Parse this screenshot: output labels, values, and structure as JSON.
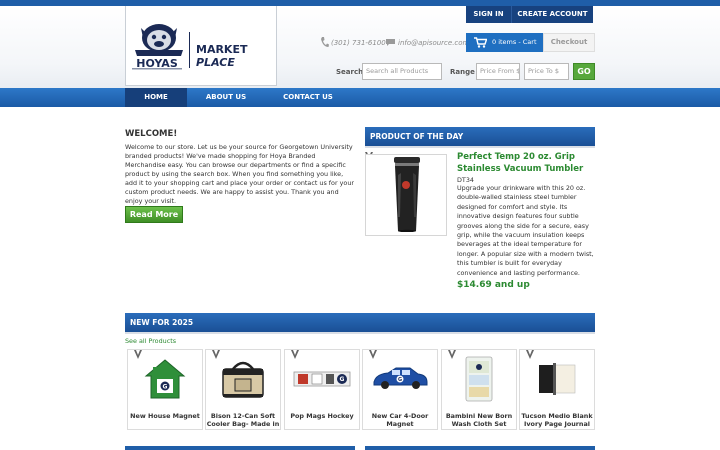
{
  "brand": {
    "logo_word": "HOYAS",
    "marketplace_line1": "MARKET",
    "marketplace_line2": "PLACE"
  },
  "account": {
    "signin": "SIGN IN",
    "create": "CREATE ACCOUNT"
  },
  "contact": {
    "phone": "(301) 731-6100",
    "email": "info@apisource.com"
  },
  "cart": {
    "label": "0 items - Cart",
    "checkout": "Checkout"
  },
  "search": {
    "label": "Search",
    "placeholder": "Search all Products",
    "range_label": "Range",
    "from_placeholder": "Price From $",
    "to_placeholder": "Price To $",
    "go": "GO"
  },
  "nav": [
    {
      "label": "HOME",
      "active": true
    },
    {
      "label": "ABOUT US",
      "active": false
    },
    {
      "label": "CONTACT US",
      "active": false
    }
  ],
  "welcome": {
    "title": "WELCOME!",
    "text": "Welcome to our store. Let us be your source for Georgetown University branded products! We've made shopping for Hoya Branded Merchandise easy. You can browse our departments or find a specific product by using the search box. When you find something you like, add it to your shopping cart and place your order or contact us for your custom product needs. We are happy to assist you. Thank you and enjoy your visit.",
    "button": "Read More"
  },
  "product_of_day": {
    "heading": "PRODUCT OF THE DAY",
    "name": "Perfect Temp 20 oz. Grip Stainless Vacuum Tumbler",
    "sku": "DT34",
    "description": "Upgrade your drinkware with this 20 oz. double-walled stainless steel tumbler designed for comfort and style. Its innovative design features four subtle grooves along the side for a secure, easy grip, while the vacuum insulation keeps beverages at the ideal temperature for longer. A popular size with a modern twist, this tumbler is built for everyday convenience and lasting performance.",
    "price": "$14.69 and up"
  },
  "new_section": {
    "heading": "NEW FOR 2025",
    "see_all": "See all Products",
    "products": [
      {
        "title": "New House Magnet"
      },
      {
        "title": "Bison 12-Can Soft Cooler Bag- Made in"
      },
      {
        "title": "Pop Mags Hockey"
      },
      {
        "title": "New Car 4-Door Magnet"
      },
      {
        "title": "Bambini New Born Wash Cloth Set"
      },
      {
        "title": "Tucson Medio Blank Ivory Page Journal"
      }
    ]
  },
  "colors": {
    "primary_blue": "#1f5ea8",
    "dark_blue": "#163f7a",
    "accent_green": "#2c8a32",
    "button_green": "#57a83c"
  }
}
